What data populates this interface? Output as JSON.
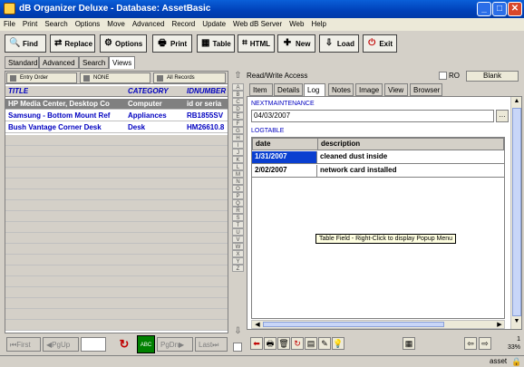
{
  "window": {
    "title": "dB Organizer Deluxe - Database: AssetBasic",
    "min": "_",
    "max": "□",
    "close": "✕"
  },
  "menu": [
    "File",
    "Print",
    "Search",
    "Options",
    "Move",
    "Advanced",
    "Record",
    "Update",
    "Web dB Server",
    "Web",
    "Help"
  ],
  "toolbar": [
    {
      "label": "Find",
      "icon": "search-icon",
      "glyph": "🔍"
    },
    {
      "label": "Replace",
      "icon": "replace-icon",
      "glyph": "⇄"
    },
    {
      "label": "Options",
      "icon": "options-icon",
      "glyph": "⚙"
    },
    {
      "label": "Print",
      "icon": "printer-icon",
      "glyph": "🖶"
    },
    {
      "label": "Table",
      "icon": "table-icon",
      "glyph": "▦"
    },
    {
      "label": "HTML",
      "icon": "html-icon",
      "glyph": "⌗"
    },
    {
      "label": "New",
      "icon": "new-doc-icon",
      "glyph": "✚"
    },
    {
      "label": "Load",
      "icon": "load-icon",
      "glyph": "⇩"
    },
    {
      "label": "Exit",
      "icon": "exit-icon",
      "glyph": "⏻"
    }
  ],
  "view_tabs": [
    "Standard",
    "Advanced",
    "Search",
    "Views"
  ],
  "sort": {
    "order": "Entry Order",
    "filter": "NONE",
    "records": "All Records"
  },
  "grid": {
    "columns": [
      "TITLE",
      "CATEGORY",
      "IDNUMBER"
    ],
    "rows": [
      [
        "HP Media Center, Desktop Co",
        "Computer",
        "id or seria"
      ],
      [
        "Samsung - Bottom Mount Ref",
        "Appliances",
        "RB1855SV"
      ],
      [
        "Bush Vantage Corner Desk",
        "Desk",
        "HM26610.8"
      ]
    ]
  },
  "nav": {
    "first": "First",
    "pgup": "PgUp",
    "pgdn": "PgDn",
    "last": "Last"
  },
  "alpha": [
    "A",
    "B",
    "C",
    "D",
    "E",
    "F",
    "G",
    "H",
    "I",
    "J",
    "K",
    "L",
    "M",
    "N",
    "O",
    "P",
    "Q",
    "R",
    "S",
    "T",
    "U",
    "V",
    "W",
    "X",
    "Y",
    "Z"
  ],
  "access": {
    "mode": "Read/Write Access",
    "ro": "RO",
    "blank": "Blank"
  },
  "record_tabs": [
    "Item",
    "Details",
    "Log",
    "Notes",
    "Image",
    "View",
    "Browser"
  ],
  "record": {
    "next_label": "NEXTMAINTENANCE",
    "next_value": "04/03/2007",
    "log_label": "LOGTABLE",
    "log_columns": [
      "date",
      "description"
    ],
    "log_rows": [
      [
        "1/31/2007",
        "cleaned dust inside"
      ],
      [
        "2/02/2007",
        "network card installed"
      ]
    ],
    "tooltip": "Table Field - Right-Click to display Popup Menu"
  },
  "status": {
    "record_no": "1",
    "zoom": "33%",
    "user": "asset"
  },
  "colors": {
    "title_blue": "#0040b8",
    "link_blue": "#0000c0",
    "selected_cell": "#0a3fd0"
  }
}
